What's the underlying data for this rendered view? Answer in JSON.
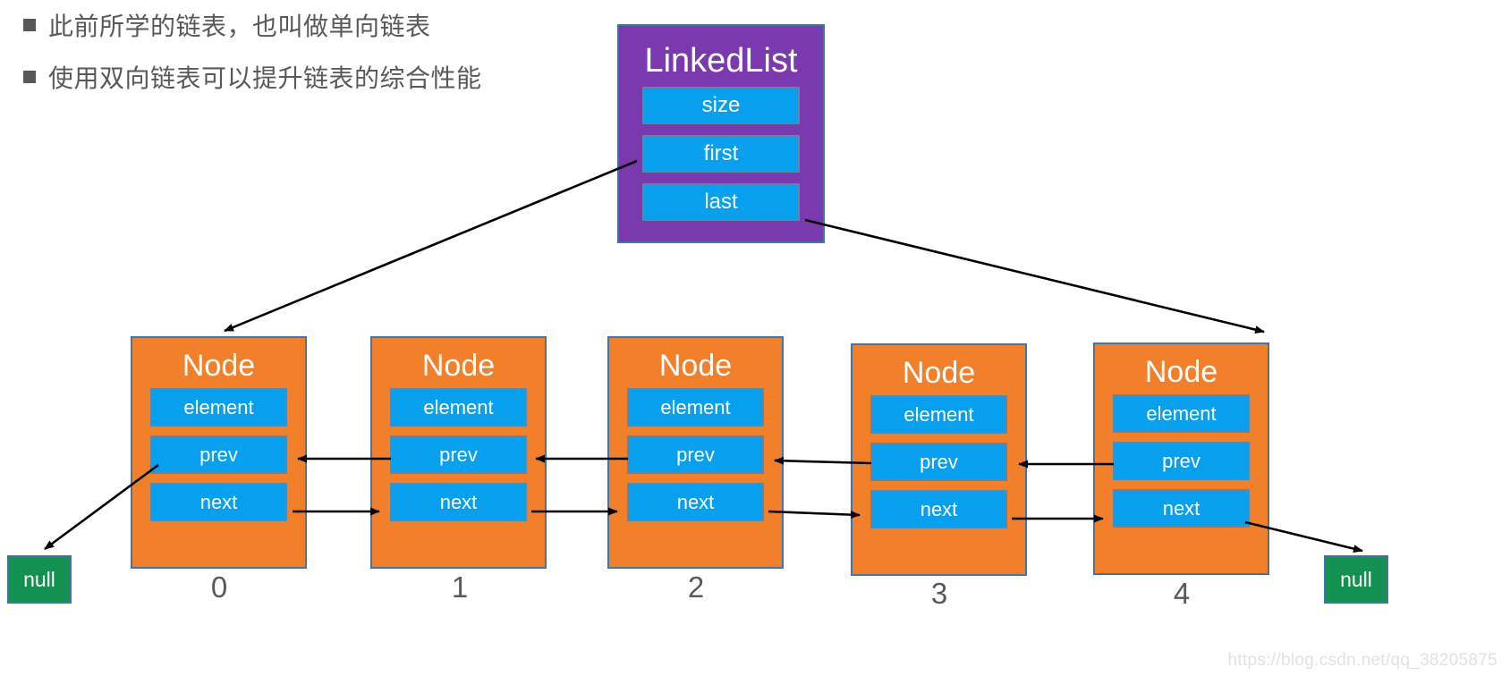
{
  "bullets": [
    {
      "text": "此前所学的链表，也叫做单向链表"
    },
    {
      "text": "使用双向链表可以提升链表的综合性能"
    }
  ],
  "linked_list": {
    "title": "LinkedList",
    "fields": [
      {
        "label": "size"
      },
      {
        "label": "first"
      },
      {
        "label": "last"
      }
    ]
  },
  "nodes": [
    {
      "title": "Node",
      "index_label": "0",
      "fields": [
        {
          "label": "element"
        },
        {
          "label": "prev"
        },
        {
          "label": "next"
        }
      ]
    },
    {
      "title": "Node",
      "index_label": "1",
      "fields": [
        {
          "label": "element"
        },
        {
          "label": "prev"
        },
        {
          "label": "next"
        }
      ]
    },
    {
      "title": "Node",
      "index_label": "2",
      "fields": [
        {
          "label": "element"
        },
        {
          "label": "prev"
        },
        {
          "label": "next"
        }
      ]
    },
    {
      "title": "Node",
      "index_label": "3",
      "fields": [
        {
          "label": "element"
        },
        {
          "label": "prev"
        },
        {
          "label": "next"
        }
      ]
    },
    {
      "title": "Node",
      "index_label": "4",
      "fields": [
        {
          "label": "element"
        },
        {
          "label": "prev"
        },
        {
          "label": "next"
        }
      ]
    }
  ],
  "null_terminators": [
    {
      "label": "null",
      "side": "left"
    },
    {
      "label": "null",
      "side": "right"
    }
  ],
  "watermark": {
    "text": "https://blog.csdn.net/qq_38205875"
  },
  "colors": {
    "linked_list_bg": "#7B39B0",
    "node_bg": "#F2802A",
    "field_bg": "#06A0EE",
    "null_bg": "#129150",
    "box_border": "#4572a7",
    "text_gray": "#595959",
    "arrow": "#000000",
    "page_bg": "#ffffff"
  }
}
